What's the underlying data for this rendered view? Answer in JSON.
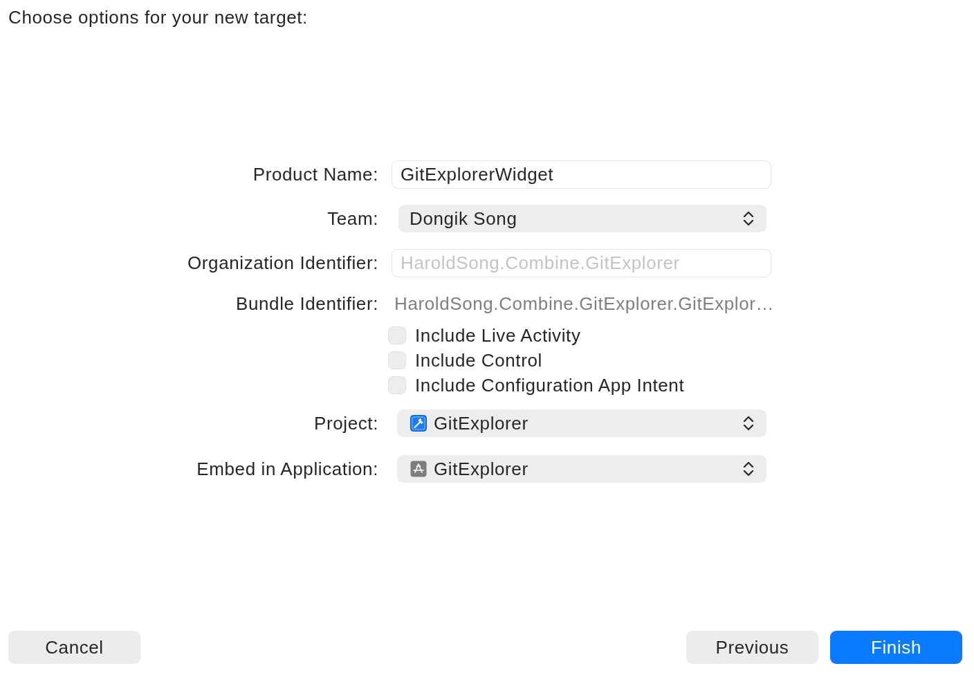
{
  "title": "Choose options for your new target:",
  "form": {
    "rows": [
      {
        "kind": "field",
        "label": "Product Name:",
        "value": "GitExplorerWidget"
      },
      {
        "kind": "popup",
        "label": "Team:",
        "value": "Dongik Song"
      },
      {
        "kind": "field",
        "label": "Organization Identifier:",
        "placeholder": "HaroldSong.Combine.GitExplorer"
      },
      {
        "kind": "static",
        "label": "Bundle Identifier:",
        "value": "HaroldSong.Combine.GitExplorer.GitExplor…"
      },
      {
        "kind": "checkbox",
        "label": "Include Live Activity",
        "checked": false
      },
      {
        "kind": "checkbox",
        "label": "Include Control",
        "checked": false
      },
      {
        "kind": "checkbox",
        "label": "Include Configuration App Intent",
        "checked": false
      },
      {
        "kind": "project",
        "label": "Project:",
        "value": "GitExplorer"
      },
      {
        "kind": "app",
        "label": "Embed in Application:",
        "value": "GitExplorer"
      }
    ]
  },
  "buttons": {
    "cancel": "Cancel",
    "previous": "Previous",
    "finish": "Finish"
  }
}
